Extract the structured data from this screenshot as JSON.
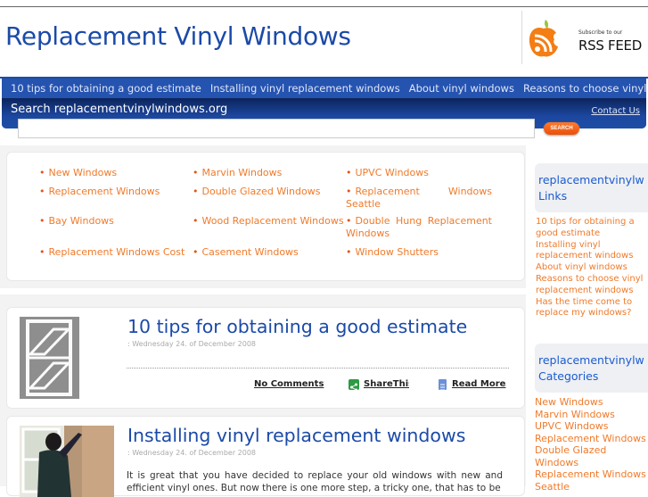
{
  "header": {
    "site_title": "Replacement Vinyl Windows",
    "rss": {
      "subscribe": "Subscribe to our",
      "feed": "RSS FEED",
      "icon": "rss-apple-icon"
    }
  },
  "nav": {
    "items": [
      "10 tips for obtaining a good estimate",
      "Installing vinyl replacement windows",
      "About vinyl windows",
      "Reasons to choose vinyl"
    ]
  },
  "search": {
    "label": "Search replacementvinylwindows.org",
    "contact": "Contact Us",
    "input_value": "",
    "button": "SEARCH"
  },
  "categories": [
    "New Windows",
    "Marvin Windows",
    "UPVC Windows",
    "Replacement Windows",
    "Double Glazed Windows",
    "Replacement Windows Seattle",
    "Bay Windows",
    "Wood Replacement Windows",
    "Double Hung Replacement Windows",
    "Replacement Windows Cost",
    "Casement Windows",
    "Window Shutters"
  ],
  "posts": [
    {
      "title": "10 tips for obtaining a good estimate",
      "date": ": Wednesday 24. of December 2008",
      "comments": "No Comments",
      "share": "ShareThis",
      "read_more": "Read More"
    },
    {
      "title": "Installing vinyl replacement windows",
      "date": ": Wednesday 24. of December 2008",
      "excerpt": "It is great that you have decided to replace your old windows with new and efficient vinyl ones. But now there is one more step, a tricky one, that has to be"
    }
  ],
  "sidebar": {
    "links_title": "replacementvinylwindows Links",
    "links_title_line1": "replacementvinylw",
    "links_title_line2": "Links",
    "links": [
      "10 tips for obtaining a good estimate",
      "Installing vinyl replacement windows",
      "About vinyl windows",
      "Reasons to choose vinyl replacement windows",
      "Has the time come to replace my windows?"
    ],
    "categories_title_line1": "replacementvinylw",
    "categories_title_line2": "Categories",
    "categories": [
      "New Windows",
      "Marvin Windows",
      "UPVC Windows",
      "Replacement Windows",
      "Double Glazed Windows",
      "Replacement Windows Seattle"
    ]
  }
}
